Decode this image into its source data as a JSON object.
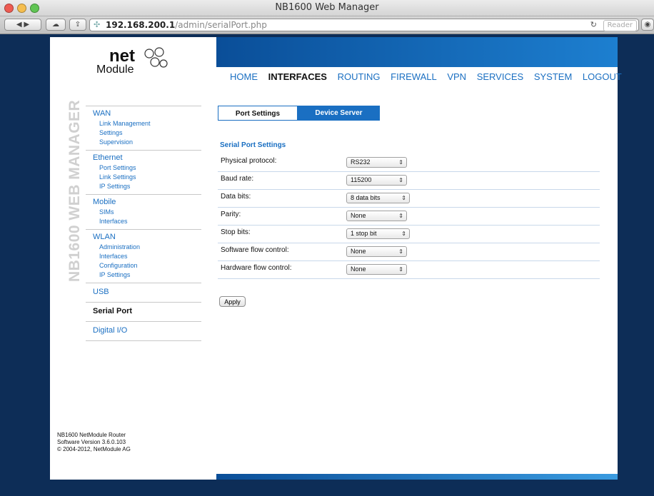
{
  "window": {
    "title": "NB1600 Web Manager",
    "url_host": "192.168.200.1",
    "url_path": "/admin/serialPort.php",
    "reader_label": "Reader"
  },
  "logo": {
    "net": "net",
    "module": "Module"
  },
  "vertical_label": "NB1600 WEB MANAGER",
  "nav": [
    "HOME",
    "INTERFACES",
    "ROUTING",
    "FIREWALL",
    "VPN",
    "SERVICES",
    "SYSTEM",
    "LOGOUT"
  ],
  "sidebar": [
    {
      "label": "WAN",
      "items": [
        "Link Management",
        "Settings",
        "Supervision"
      ]
    },
    {
      "label": "Ethernet",
      "items": [
        "Port Settings",
        "Link Settings",
        "IP Settings"
      ]
    },
    {
      "label": "Mobile",
      "items": [
        "SIMs",
        "Interfaces"
      ]
    },
    {
      "label": "WLAN",
      "items": [
        "Administration",
        "Interfaces",
        "Configuration",
        "IP Settings"
      ]
    },
    {
      "label": "USB",
      "items": []
    },
    {
      "label": "Serial Port",
      "items": []
    },
    {
      "label": "Digital I/O",
      "items": []
    }
  ],
  "footer": {
    "line1": "NB1600 NetModule Router",
    "line2": "Software Version 3.6.0.103",
    "line3": "© 2004-2012, NetModule AG"
  },
  "tabs": [
    "Port Settings",
    "Device Server"
  ],
  "section_title": "Serial Port Settings",
  "rows": [
    {
      "label": "Physical protocol:",
      "value": "RS232"
    },
    {
      "label": "Baud rate:",
      "value": "115200"
    },
    {
      "label": "Data bits:",
      "value": "8 data bits"
    },
    {
      "label": "Parity:",
      "value": "None"
    },
    {
      "label": "Stop bits:",
      "value": "1 stop bit"
    },
    {
      "label": "Software flow control:",
      "value": "None"
    },
    {
      "label": "Hardware flow control:",
      "value": "None"
    }
  ],
  "apply_label": "Apply"
}
